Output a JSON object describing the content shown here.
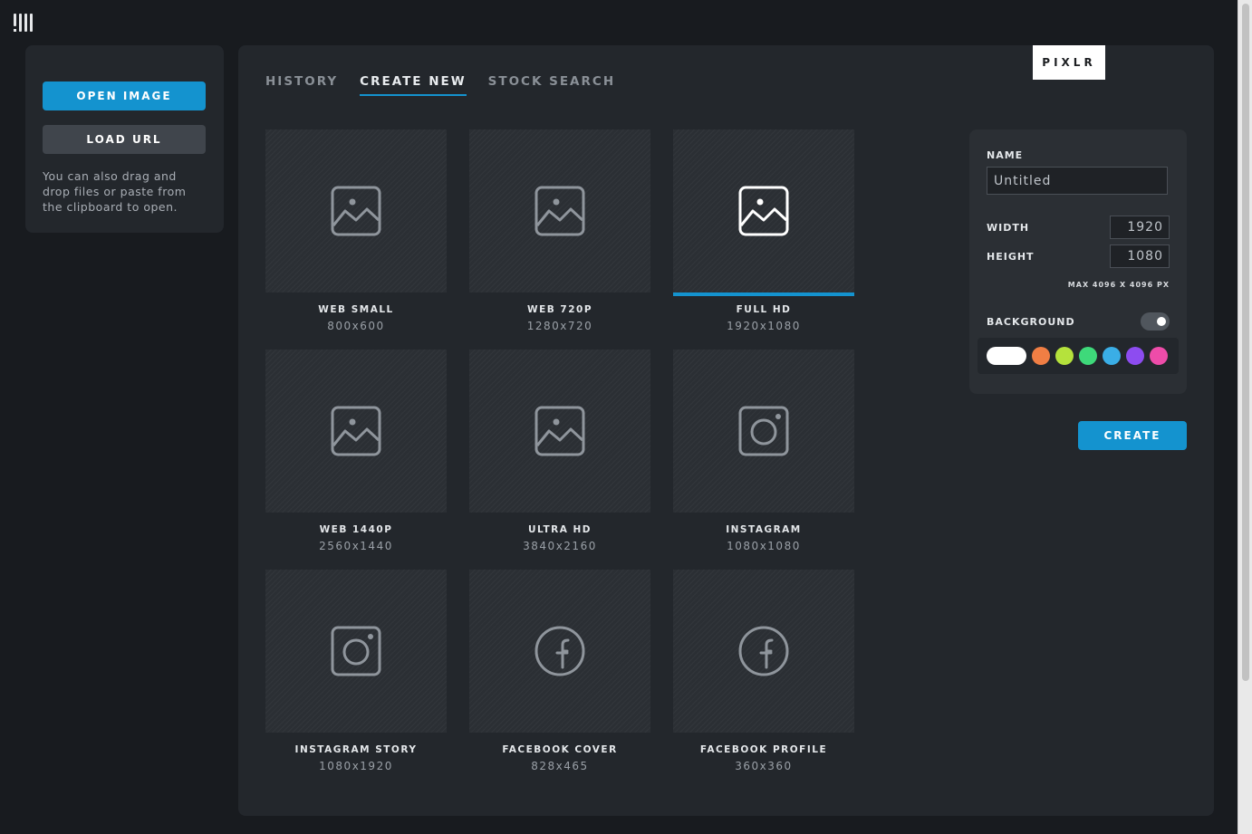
{
  "left_panel": {
    "open_image_label": "OPEN IMAGE",
    "load_url_label": "LOAD URL",
    "helper_text": "You can also drag and drop files or paste from the clipboard to open."
  },
  "brand": "PIXLR",
  "tabs": [
    {
      "label": "HISTORY",
      "active": false
    },
    {
      "label": "CREATE NEW",
      "active": true
    },
    {
      "label": "STOCK SEARCH",
      "active": false
    }
  ],
  "presets": [
    {
      "title": "WEB SMALL",
      "size": "800x600",
      "icon": "image-icon"
    },
    {
      "title": "WEB 720P",
      "size": "1280x720",
      "icon": "image-icon"
    },
    {
      "title": "FULL HD",
      "size": "1920x1080",
      "icon": "image-icon",
      "selected": true
    },
    {
      "title": "WEB 1440P",
      "size": "2560x1440",
      "icon": "image-icon"
    },
    {
      "title": "ULTRA HD",
      "size": "3840x2160",
      "icon": "image-icon"
    },
    {
      "title": "INSTAGRAM",
      "size": "1080x1080",
      "icon": "instagram-icon"
    },
    {
      "title": "INSTAGRAM STORY",
      "size": "1080x1920",
      "icon": "instagram-icon"
    },
    {
      "title": "FACEBOOK COVER",
      "size": "828x465",
      "icon": "facebook-icon"
    },
    {
      "title": "FACEBOOK PROFILE",
      "size": "360x360",
      "icon": "facebook-icon"
    }
  ],
  "settings": {
    "name_label": "NAME",
    "name_value": "Untitled",
    "width_label": "WIDTH",
    "width_value": "1920",
    "height_label": "HEIGHT",
    "height_value": "1080",
    "max_note": "MAX 4096 X 4096 PX",
    "background_label": "BACKGROUND",
    "background_enabled": true,
    "swatches": [
      "#ffffff",
      "#f07e44",
      "#b5e23c",
      "#3ed97a",
      "#3aaee6",
      "#8d4cf0",
      "#ee4ca9"
    ]
  },
  "create_label": "CREATE",
  "colors": {
    "accent": "#1493cf",
    "panel": "#23272c",
    "background": "#181b1f"
  }
}
